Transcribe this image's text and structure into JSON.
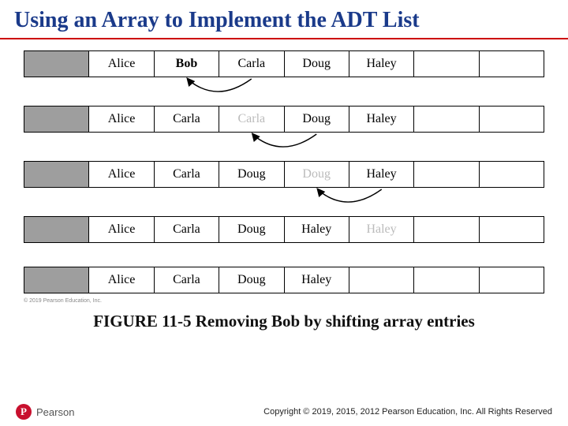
{
  "title": "Using an Array to Implement the ADT List",
  "figure_caption": "FIGURE 11-5 Removing Bob by shifting array entries",
  "image_copyright": "© 2019 Pearson Education, Inc.",
  "footer": {
    "logo_letter": "P",
    "brand": "Pearson",
    "copyright": "Copyright © 2019, 2015, 2012 Pearson Education, Inc. All Rights Reserved"
  },
  "num_cells": 8,
  "rows": [
    {
      "cells": [
        {
          "text": "",
          "shaded": true
        },
        {
          "text": "Alice"
        },
        {
          "text": "Bob",
          "bold": true
        },
        {
          "text": "Carla"
        },
        {
          "text": "Doug"
        },
        {
          "text": "Haley"
        },
        {
          "text": ""
        },
        {
          "text": ""
        }
      ],
      "arrow": {
        "from_cell": 3,
        "to_cell": 2
      }
    },
    {
      "cells": [
        {
          "text": "",
          "shaded": true
        },
        {
          "text": "Alice"
        },
        {
          "text": "Carla"
        },
        {
          "text": "Carla",
          "faded": true
        },
        {
          "text": "Doug"
        },
        {
          "text": "Haley"
        },
        {
          "text": ""
        },
        {
          "text": ""
        }
      ],
      "arrow": {
        "from_cell": 4,
        "to_cell": 3
      }
    },
    {
      "cells": [
        {
          "text": "",
          "shaded": true
        },
        {
          "text": "Alice"
        },
        {
          "text": "Carla"
        },
        {
          "text": "Doug"
        },
        {
          "text": "Doug",
          "faded": true
        },
        {
          "text": "Haley"
        },
        {
          "text": ""
        },
        {
          "text": ""
        }
      ],
      "arrow": {
        "from_cell": 5,
        "to_cell": 4
      }
    },
    {
      "cells": [
        {
          "text": "",
          "shaded": true
        },
        {
          "text": "Alice"
        },
        {
          "text": "Carla"
        },
        {
          "text": "Doug"
        },
        {
          "text": "Haley"
        },
        {
          "text": "Haley",
          "faded": true
        },
        {
          "text": ""
        },
        {
          "text": ""
        }
      ],
      "arrow": null
    },
    {
      "cells": [
        {
          "text": "",
          "shaded": true
        },
        {
          "text": "Alice"
        },
        {
          "text": "Carla"
        },
        {
          "text": "Doug"
        },
        {
          "text": "Haley"
        },
        {
          "text": ""
        },
        {
          "text": ""
        },
        {
          "text": ""
        }
      ],
      "arrow": null
    }
  ]
}
